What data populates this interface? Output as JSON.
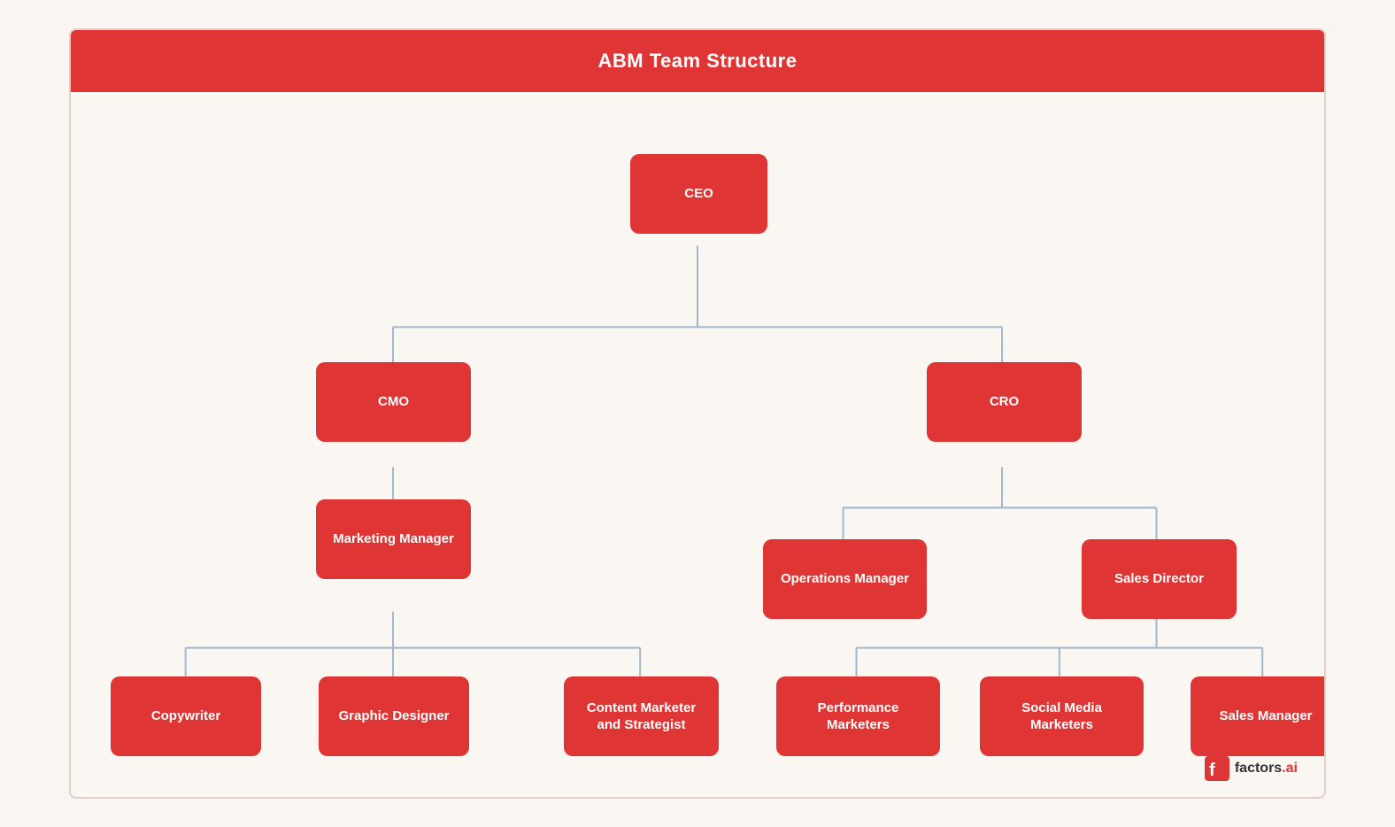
{
  "header": {
    "title": "ABM Team Structure"
  },
  "nodes": {
    "ceo": {
      "label": "CEO"
    },
    "cmo": {
      "label": "CMO"
    },
    "cro": {
      "label": "CRO"
    },
    "marketing_manager": {
      "label": "Marketing Manager"
    },
    "operations_manager": {
      "label": "Operations Manager"
    },
    "sales_director": {
      "label": "Sales Director"
    },
    "copywriter": {
      "label": "Copywriter"
    },
    "graphic_designer": {
      "label": "Graphic Designer"
    },
    "content_marketer": {
      "label": "Content Marketer and Strategist"
    },
    "performance_marketers": {
      "label": "Performance Marketers"
    },
    "social_media_marketers": {
      "label": "Social Media Marketers"
    },
    "sales_manager": {
      "label": "Sales Manager"
    }
  },
  "logo": {
    "text": "factors.ai"
  },
  "colors": {
    "node_bg": "#e03535",
    "connector": "#a0b8cc",
    "header_bg": "#e03535",
    "bg": "#faf6f2"
  }
}
